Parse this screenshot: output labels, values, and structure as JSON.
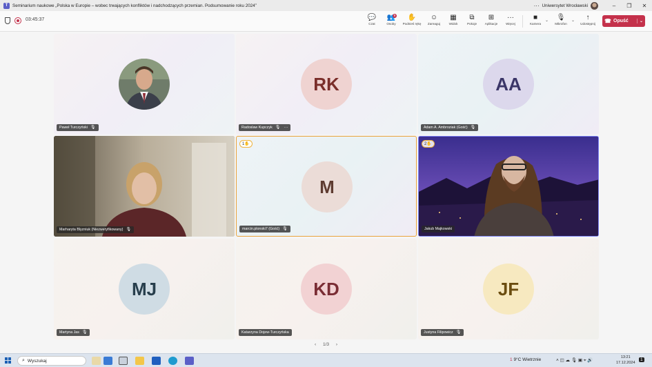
{
  "window": {
    "title": "Seminarium naukowe „Polska w Europie – wobec trwających konfliktów i nadchodzących przemian. Podsumowanie roku 2024”",
    "more": "···",
    "org": "Uniwersytet Wrocławski",
    "controls": {
      "minimize": "–",
      "restore": "❐",
      "close": "✕"
    }
  },
  "meeting": {
    "timer": "03:45:37",
    "toolbar": [
      {
        "key": "chat",
        "label": "Czat",
        "icon": "💬"
      },
      {
        "key": "people",
        "label": "Osoby",
        "icon": "👥",
        "badge": "9"
      },
      {
        "key": "raise",
        "label": "Podnieś rękę",
        "icon": "✋"
      },
      {
        "key": "react",
        "label": "Zareaguj",
        "icon": "☺"
      },
      {
        "key": "view",
        "label": "Widok",
        "icon": "▦"
      },
      {
        "key": "rooms",
        "label": "Pokoje",
        "icon": "⧉"
      },
      {
        "key": "apps",
        "label": "Aplikacje",
        "icon": "⊞"
      },
      {
        "key": "more",
        "label": "Więcej",
        "icon": "···"
      },
      {
        "key": "camera",
        "label": "Kamera",
        "icon": "■"
      },
      {
        "key": "mic",
        "label": "Mikrofon",
        "icon": "🎙"
      },
      {
        "key": "share",
        "label": "Udostępnij",
        "icon": "↑"
      }
    ],
    "leave_label": "Opuść",
    "leave_icon": "☎",
    "caret": "⌄"
  },
  "participants": [
    {
      "name": "Paweł Turczyński",
      "initials": "",
      "has_photo": true,
      "mic": "🎙"
    },
    {
      "name": "Radoslaw Kupczyk",
      "initials": "RK",
      "mic": "🎙",
      "menu": "···",
      "avatar_bg": "#efd3d1",
      "avatar_fg": "#7a2e2a"
    },
    {
      "name": "Adam A. Ambroziak (Gość)",
      "initials": "AA",
      "mic": "🎙",
      "avatar_bg": "#dcd8ec",
      "avatar_fg": "#3b3668"
    },
    {
      "name": "Marharyta Blyzniuk (Niezweryfikowany)",
      "initials": "",
      "has_video": true,
      "mic": "🎙"
    },
    {
      "name": "marcin.plonski7 (Gość)",
      "initials": "M",
      "mic": "🎙",
      "raised_hand": "1✋",
      "avatar_bg": "#ebdcd7",
      "avatar_fg": "#5e3b30"
    },
    {
      "name": "Jakub Majkowski",
      "initials": "",
      "has_video": true,
      "raised_hand": "2✋"
    },
    {
      "name": "Martyna Jas",
      "initials": "MJ",
      "mic": "🎙",
      "avatar_bg": "#cfdce4",
      "avatar_fg": "#273e4c"
    },
    {
      "name": "Katarzyna Dojew-Turczyńska",
      "initials": "KD",
      "avatar_bg": "#f2d2d3",
      "avatar_fg": "#7a2d34"
    },
    {
      "name": "Justyna Filipowicz",
      "initials": "JF",
      "mic": "🎙",
      "avatar_bg": "#f7e9c0",
      "avatar_fg": "#6b4d10"
    }
  ],
  "pager": {
    "prev": "‹",
    "label": "1/3",
    "next": "›"
  },
  "taskbar": {
    "search_placeholder": "Wyszukaj",
    "search_icon": "⌕",
    "weather_badge": "1",
    "weather": "9°C  Wietrznie",
    "tray_icons": "˄  ◫  ☁  🎙  ▣  ⌖  🔊",
    "time": "13:21",
    "date": "17.12.2024",
    "notif_badge": "1",
    "colors": {
      "accent": "#1a5fb4"
    }
  }
}
